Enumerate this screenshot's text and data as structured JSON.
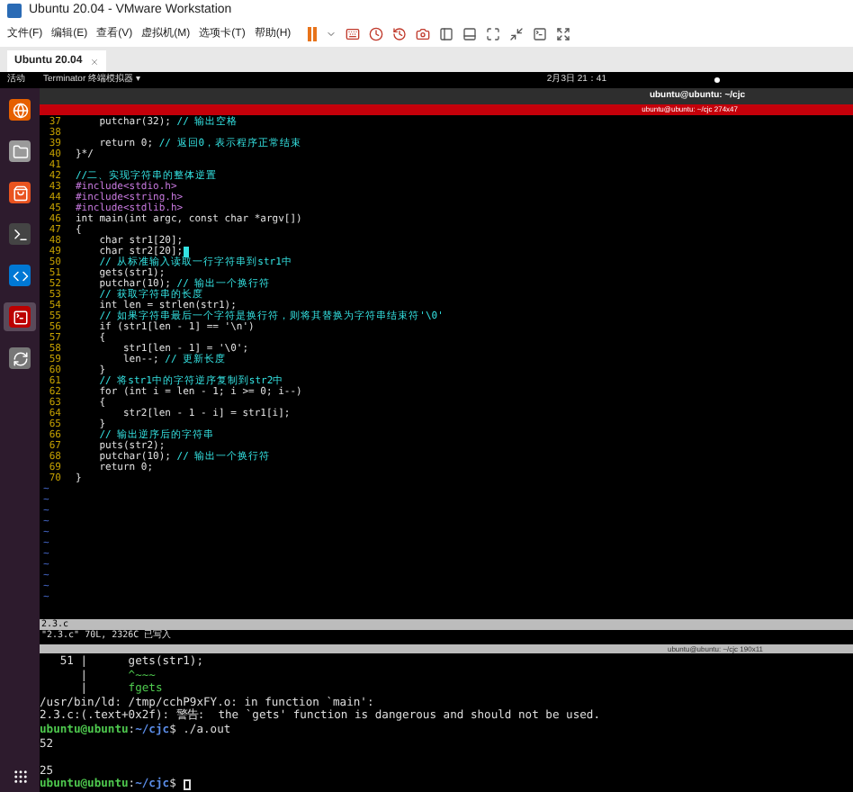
{
  "window": {
    "title": "Ubuntu 20.04 - VMware Workstation"
  },
  "menu": [
    "文件(F)",
    "编辑(E)",
    "查看(V)",
    "虚拟机(M)",
    "选项卡(T)",
    "帮助(H)"
  ],
  "tabs": [
    {
      "label": "Ubuntu 20.04",
      "selected": true
    }
  ],
  "top_bar": {
    "activities": "活动",
    "app": "Terminator 终端模拟器 ▾",
    "clock": "2月3日 21：41"
  },
  "dock": [
    {
      "kind": "browser",
      "selected": false
    },
    {
      "kind": "files",
      "selected": false
    },
    {
      "kind": "store",
      "selected": false
    },
    {
      "kind": "terminal",
      "selected": false
    },
    {
      "kind": "editor",
      "selected": false
    },
    {
      "kind": "terminator",
      "selected": true
    },
    {
      "kind": "updater",
      "selected": false
    }
  ],
  "terminal_title": "ubuntu@ubuntu: ~/cjc",
  "pane1_title": "ubuntu@ubuntu: ~/cjc 274x47",
  "code": [
    {
      "num": "37",
      "code": "    putchar(32); ",
      "comment": "// 输出空格"
    },
    {
      "num": "38"
    },
    {
      "num": "39",
      "code": "    return 0; ",
      "comment": "// 返回0，表示程序正常结束"
    },
    {
      "num": "40",
      "code": "}*/"
    },
    {
      "num": "41"
    },
    {
      "num": "42",
      "comment": "//二、实现字符串的整体逆置"
    },
    {
      "num": "43",
      "code": "#include<stdio.h>",
      "kind": "preproc"
    },
    {
      "num": "44",
      "code": "#include<string.h>",
      "kind": "preproc"
    },
    {
      "num": "45",
      "code": "#include<stdlib.h>",
      "kind": "preproc"
    },
    {
      "num": "46",
      "code": "int main(int argc, const char *argv[])"
    },
    {
      "num": "47",
      "code": "{"
    },
    {
      "num": "48",
      "code": "    char str1[20];"
    },
    {
      "num": "49",
      "code": "    char str2[20];",
      "cursor": true
    },
    {
      "num": "50",
      "comment": "    // 从标准输入读取一行字符串到str1中"
    },
    {
      "num": "51",
      "code": "    gets(str1);"
    },
    {
      "num": "52",
      "code": "    putchar(10); ",
      "comment": "// 输出一个换行符"
    },
    {
      "num": "53",
      "comment": "    // 获取字符串的长度"
    },
    {
      "num": "54",
      "code": "    int len = strlen(str1);"
    },
    {
      "num": "55",
      "comment": "    // 如果字符串最后一个字符是换行符，则将其替换为字符串结束符'\\0'"
    },
    {
      "num": "56",
      "code": "    if (str1[len - 1] == '\\n')"
    },
    {
      "num": "57",
      "code": "    {"
    },
    {
      "num": "58",
      "code": "        str1[len - 1] = '\\0';"
    },
    {
      "num": "59",
      "code": "        len--; ",
      "comment": "// 更新长度"
    },
    {
      "num": "60",
      "code": "    }"
    },
    {
      "num": "61",
      "comment": "    // 将str1中的字符逆序复制到str2中"
    },
    {
      "num": "62",
      "code": "    for (int i = len - 1; i >= 0; i--)"
    },
    {
      "num": "63",
      "code": "    {"
    },
    {
      "num": "64",
      "code": "        str2[len - 1 - i] = str1[i];"
    },
    {
      "num": "65",
      "code": "    }"
    },
    {
      "num": "66",
      "comment": "    // 输出逆序后的字符串"
    },
    {
      "num": "67",
      "code": "    puts(str2);"
    },
    {
      "num": "68",
      "code": "    putchar(10); ",
      "comment": "// 输出一个换行符"
    },
    {
      "num": "69",
      "code": "    return 0;"
    },
    {
      "num": "70",
      "code": "}"
    }
  ],
  "empty_lines": [
    "~",
    "~",
    "~",
    "~",
    "~",
    "~",
    "~",
    "~",
    "~",
    "~",
    "~"
  ],
  "vim_status": "2.3.c",
  "vim_message": "\"2.3.c\" 70L, 2326C 已写入",
  "pane2_title": "ubuntu@ubuntu: ~/cjc 190x11",
  "output": [
    {
      "kind": "source",
      "gutter": "   51 |",
      "text": "      gets(str1);"
    },
    {
      "kind": "hint",
      "gutter": "      |",
      "text": "      ^~~~"
    },
    {
      "kind": "hint",
      "gutter": "      |",
      "text": "      fgets"
    },
    {
      "kind": "text",
      "text": "/usr/bin/ld: /tmp/cchP9xFY.o: in function `main':"
    },
    {
      "kind": "text",
      "text": "2.3.c:(.text+0x2f): 警告:  the `gets' function is dangerous and should not be used."
    },
    {
      "kind": "prompt",
      "user": "ubuntu@ubuntu",
      "sep": ":",
      "path": "~/cjc",
      "command": "$ ./a.out"
    },
    {
      "kind": "text",
      "text": "52"
    },
    {
      "kind": "blank"
    },
    {
      "kind": "text",
      "text": "25"
    },
    {
      "kind": "prompt",
      "user": "ubuntu@ubuntu",
      "sep": ":",
      "path": "~/cjc",
      "command": "$ ",
      "cursor": true
    }
  ]
}
